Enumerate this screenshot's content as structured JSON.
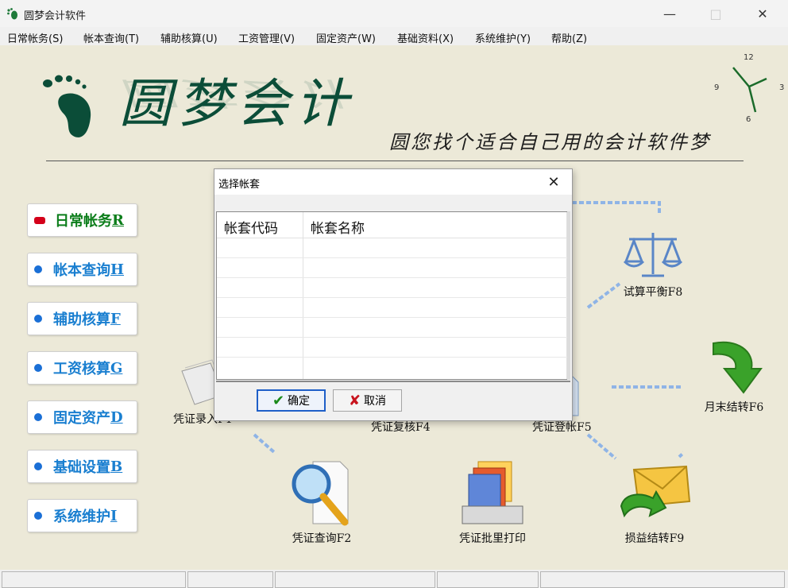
{
  "window": {
    "title": "圆梦会计软件"
  },
  "menu": [
    "日常帐务(S)",
    "帐本查询(T)",
    "辅助核算(U)",
    "工资管理(V)",
    "固定资产(W)",
    "基础资料(X)",
    "系统维护(Y)",
    "帮助(Z)"
  ],
  "banner": {
    "logo_text": "圆梦会计",
    "slogan": "圆您找个适合自己用的会计软件梦",
    "clock_ticks": {
      "t12": "12",
      "t3": "3",
      "t6": "6",
      "t9": "9"
    }
  },
  "sidebar": [
    {
      "label": "日常帐务",
      "key": "R",
      "active": true
    },
    {
      "label": "帐本查询",
      "key": "H"
    },
    {
      "label": "辅助核算",
      "key": "F"
    },
    {
      "label": "工资核算",
      "key": "G"
    },
    {
      "label": "固定资产",
      "key": "D"
    },
    {
      "label": "基础设置",
      "key": "B"
    },
    {
      "label": "系统维护",
      "key": "I"
    }
  ],
  "flow": {
    "trial_balance": "试算平衡F8",
    "voucher_entry": "凭证录入F1",
    "voucher_audit": "凭证复核F4",
    "voucher_post": "凭证登帐F5",
    "month_end": "月末结转F6",
    "voucher_query": "凭证查询F2",
    "batch_print": "凭证批里打印",
    "pl_transfer": "损益结转F9"
  },
  "dialog": {
    "title": "选择帐套",
    "columns": [
      "帐套代码",
      "帐套名称"
    ],
    "ok_label": "确定",
    "cancel_label": "取消"
  },
  "colors": {
    "accent": "#1a7fd0",
    "active": "#0b7d1a",
    "background": "#ece9d8",
    "logo": "#0b4d38"
  }
}
